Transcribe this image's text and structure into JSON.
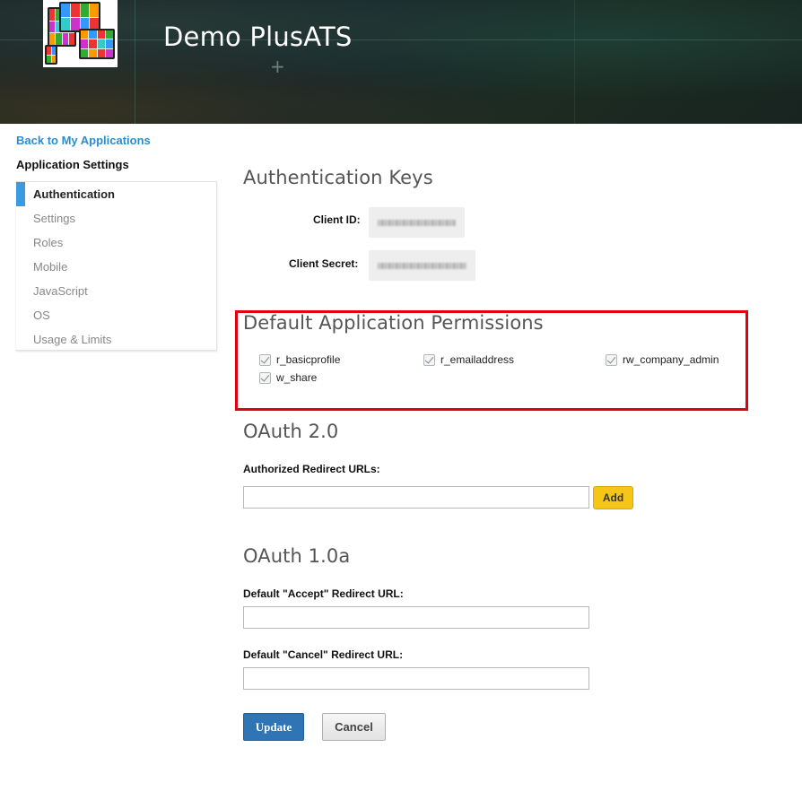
{
  "header": {
    "app_title": "Demo PlusATS",
    "logo_icon": "app-logo-devices-icon"
  },
  "sidebar": {
    "back_link": "Back to My Applications",
    "heading": "Application Settings",
    "items": [
      {
        "label": "Authentication",
        "active": true
      },
      {
        "label": "Settings",
        "active": false
      },
      {
        "label": "Roles",
        "active": false
      },
      {
        "label": "Mobile",
        "active": false
      },
      {
        "label": "JavaScript",
        "active": false
      },
      {
        "label": "OS",
        "active": false
      },
      {
        "label": "Usage & Limits",
        "active": false
      }
    ],
    "active_color": "#3b9ae1"
  },
  "auth_keys": {
    "title": "Authentication Keys",
    "client_id_label": "Client ID:",
    "client_secret_label": "Client Secret:"
  },
  "permissions": {
    "title": "Default Application Permissions",
    "highlight_color": "#e0000f",
    "items": [
      {
        "label": "r_basicprofile",
        "checked": true
      },
      {
        "label": "r_emailaddress",
        "checked": true
      },
      {
        "label": "rw_company_admin",
        "checked": true
      },
      {
        "label": "w_share",
        "checked": true
      }
    ]
  },
  "oauth2": {
    "title": "OAuth 2.0",
    "redirect_label": "Authorized Redirect URLs:",
    "redirect_value": "",
    "add_label": "Add"
  },
  "oauth1": {
    "title": "OAuth 1.0a",
    "accept_label": "Default \"Accept\" Redirect URL:",
    "accept_value": "",
    "cancel_label": "Default \"Cancel\" Redirect URL:",
    "cancel_value": ""
  },
  "actions": {
    "update_label": "Update",
    "cancel_label": "Cancel",
    "update_color": "#2f75b5",
    "add_color": "#f5c518"
  }
}
